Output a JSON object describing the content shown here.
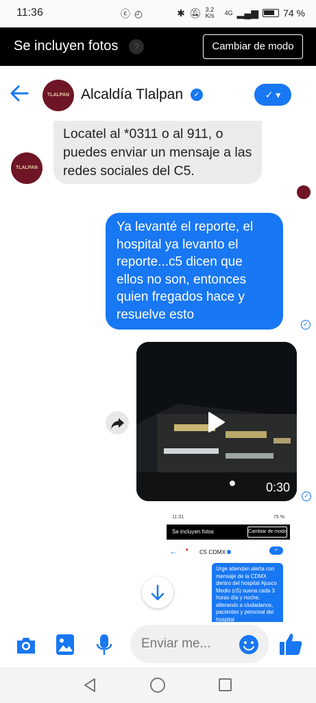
{
  "status_bar": {
    "time": "11:36",
    "mid_icons": "ⓒ ◴",
    "net_speed": "3.2 K/s",
    "net_type": "4G",
    "battery": "74 %"
  },
  "banner": {
    "text": "Se incluyen fotos",
    "help_icon": "?",
    "button": "Cambiar de modo"
  },
  "header": {
    "avatar_text": "TLALPAN",
    "name": "Alcaldía Tlalpan",
    "verified_icon": "✓",
    "mode_icon": "✓ ▾"
  },
  "messages": {
    "incoming_avatar_text": "TLALPAN",
    "incoming_text": "Locatel al *0311 o al 911, o puedes enviar un mensaje a las redes sociales del C5.",
    "outgoing_text": "Ya levanté el reporte, el hospital ya levanto el reporte...c5 dicen que ellos no son, entonces quien fregados hace y resuelve esto",
    "video_duration": "0:30",
    "check_glyph": "✓"
  },
  "thumbnail": {
    "time": "11:31",
    "status_right": "75 %",
    "banner_text": "Se incluyen fotos",
    "banner_button": "Cambiar de modo",
    "back": "←",
    "contact_name": "C5 CDMX",
    "pill": "✓",
    "bubble_text": "Urge atiendan alerta con mensaje de la CDMX dentro del hospital Ajusco Medio (c5) suena cada 3 horas día y noche, alterando a ciudadanos, pacientes y personal del hospital"
  },
  "composer": {
    "placeholder": "Enviar me..."
  },
  "colors": {
    "accent": "#1877f2",
    "brand_maroon": "#6e1526",
    "incoming_bubble": "#ebebeb"
  }
}
